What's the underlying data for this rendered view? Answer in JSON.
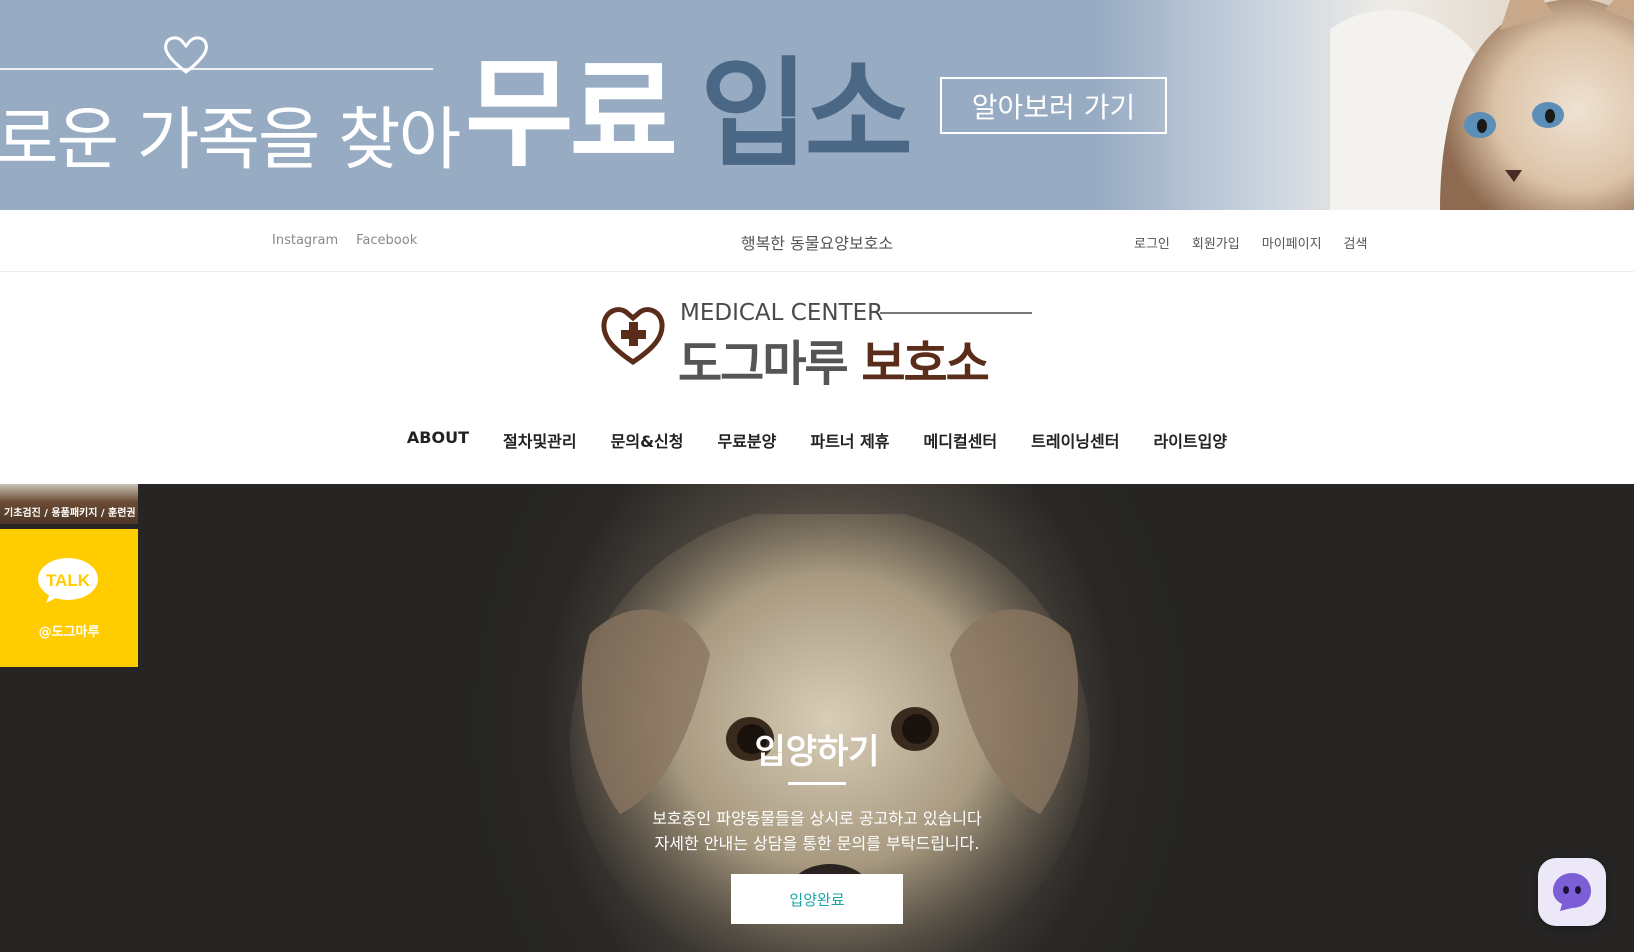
{
  "banner": {
    "text": "로운 가족을 찾아",
    "free": "무료",
    "entry": "입소",
    "button": "알아보러 가기"
  },
  "util": {
    "social": [
      "Instagram",
      "Facebook"
    ],
    "tagline": "행복한 동물요양보호소",
    "links": [
      "로그인",
      "회원가입",
      "마이페이지",
      "검색"
    ]
  },
  "logo": {
    "top": "MEDICAL CENTER",
    "main_gray": "도그마루",
    "main_brown": "보호소"
  },
  "nav": [
    "ABOUT",
    "절차및관리",
    "문의&신청",
    "무료분양",
    "파트너 제휴",
    "메디컬센터",
    "트레이닝센터",
    "라이트입양"
  ],
  "hero": {
    "title": "입양하기",
    "desc_line1": "보호중인 파양동물들을 상시로 공고하고 있습니다",
    "desc_line2": "자세한 안내는 상담을 통한 문의를 부탁드립니다.",
    "button": "입양완료"
  },
  "side": {
    "promo": "기초검진 / 용품패키지 / 훈련권",
    "kakao_icon": "TALK",
    "kakao_label": "@도그마루"
  },
  "colors": {
    "banner_bg": "#97abc3",
    "entry_text": "#4a6885",
    "logo_brown": "#5a2c1a",
    "kakao": "#ffcc00",
    "hero_btn_text": "#1aa6a6"
  },
  "icons": [
    "heart-outline-icon",
    "cat-photo",
    "medical-heart-icon",
    "dog-photo",
    "kakao-talk-icon",
    "chat-bot-icon"
  ]
}
